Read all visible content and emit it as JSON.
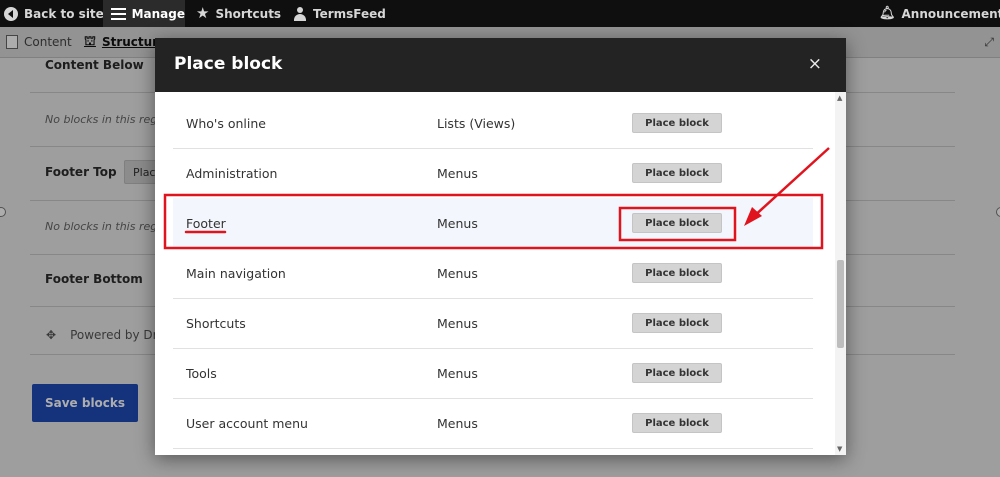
{
  "toolbar": {
    "back_to_site": "Back to site",
    "manage": "Manage",
    "shortcuts": "Shortcuts",
    "user": "TermsFeed",
    "announcements": "Announcements"
  },
  "tabs": {
    "content": "Content",
    "structure": "Structure"
  },
  "background": {
    "content_below": "Content Below",
    "footer_top": "Footer Top",
    "footer_bottom": "Footer Bottom",
    "place_fragment": "Plac",
    "no_blocks": "No blocks in this reg",
    "powered": "Powered by Dru",
    "save_blocks": "Save blocks"
  },
  "modal": {
    "title": "Place block",
    "close": "×",
    "rows": [
      {
        "name": "Who's online",
        "category": "Lists (Views)",
        "button": "Place block"
      },
      {
        "name": "Administration",
        "category": "Menus",
        "button": "Place block"
      },
      {
        "name": "Footer",
        "category": "Menus",
        "button": "Place block"
      },
      {
        "name": "Main navigation",
        "category": "Menus",
        "button": "Place block"
      },
      {
        "name": "Shortcuts",
        "category": "Menus",
        "button": "Place block"
      },
      {
        "name": "Tools",
        "category": "Menus",
        "button": "Place block"
      },
      {
        "name": "User account menu",
        "category": "Menus",
        "button": "Place block"
      }
    ]
  },
  "colors": {
    "annotation": "#e0141e",
    "primary_button": "#1f4ab8"
  }
}
